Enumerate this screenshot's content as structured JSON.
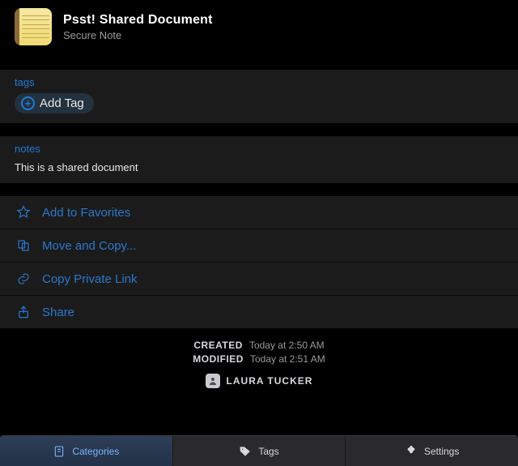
{
  "header": {
    "title": "Psst! Shared Document",
    "subtitle": "Secure Note"
  },
  "sections": {
    "tags": {
      "label": "tags",
      "add_button": "Add Tag"
    },
    "notes": {
      "label": "notes",
      "content": "This is a shared document"
    }
  },
  "actions": {
    "favorites": "Add to Favorites",
    "move": "Move and Copy...",
    "link": "Copy Private Link",
    "share": "Share"
  },
  "meta": {
    "created_key": "CREATED",
    "created_val": "Today at 2:50 AM",
    "modified_key": "MODIFIED",
    "modified_val": "Today at 2:51 AM",
    "author": "LAURA TUCKER"
  },
  "tabs": {
    "categories": "Categories",
    "tags": "Tags",
    "settings": "Settings"
  }
}
